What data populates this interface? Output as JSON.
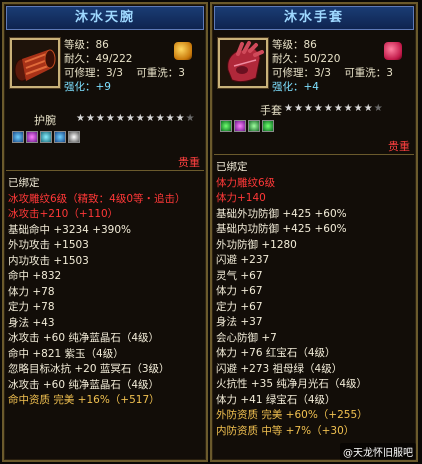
{
  "left": {
    "title": "沐水天腕",
    "info": {
      "level": "等级：86",
      "durability": "耐久：49/222",
      "repairable": "可修理：3/3",
      "rewash": "可重洗：3",
      "enhance_label": "强化：",
      "enhance_value": "+9"
    },
    "type": "护腕",
    "stars_filled": "★★★★★★★★★★★",
    "stars_dim": "★",
    "expensive": "贵重",
    "stats": [
      {
        "t": "已绑定",
        "c": "w"
      },
      {
        "t": "冰攻雕纹6级（精致：4级0等・追击）",
        "c": "r"
      },
      {
        "t": "冰攻击+210（+110）",
        "c": "r"
      },
      {
        "t": "基础命中 +3234 +390%",
        "c": "w"
      },
      {
        "t": "外功攻击 +1503",
        "c": "w"
      },
      {
        "t": "内功攻击 +1503",
        "c": "w"
      },
      {
        "t": "命中 +832",
        "c": "w"
      },
      {
        "t": "体力 +78",
        "c": "w"
      },
      {
        "t": "定力 +78",
        "c": "w"
      },
      {
        "t": "身法 +43",
        "c": "w"
      },
      {
        "t": "冰攻击 +60 纯净蓝晶石（4级）",
        "c": "w"
      },
      {
        "t": "命中 +821 紫玉（4级）",
        "c": "w"
      },
      {
        "t": "忽略目标冰抗 +20 蓝冥石（3级）",
        "c": "w"
      },
      {
        "t": "冰攻击 +60 纯净蓝晶石（4级）",
        "c": "w"
      },
      {
        "t": "命中资质  完美 +16%（+517）",
        "c": "y"
      }
    ]
  },
  "right": {
    "title": "沐水手套",
    "info": {
      "level": "等级：86",
      "durability": "耐久：50/220",
      "repairable": "可修理：3/3",
      "rewash": "可重洗：3",
      "enhance_label": "强化：",
      "enhance_value": "+4"
    },
    "type": "手套",
    "stars_filled": "★★★★★★★★★",
    "stars_dim": "★",
    "expensive": "贵重",
    "stats": [
      {
        "t": "已绑定",
        "c": "w"
      },
      {
        "t": "体力雕纹6级",
        "c": "r"
      },
      {
        "t": "体力+140",
        "c": "r"
      },
      {
        "t": "基础外功防御 +425 +60%",
        "c": "w"
      },
      {
        "t": "基础内功防御 +425 +60%",
        "c": "w"
      },
      {
        "t": "外功防御 +1280",
        "c": "w"
      },
      {
        "t": "闪避 +237",
        "c": "w"
      },
      {
        "t": "灵气 +67",
        "c": "w"
      },
      {
        "t": "体力 +67",
        "c": "w"
      },
      {
        "t": "定力 +67",
        "c": "w"
      },
      {
        "t": "身法 +37",
        "c": "w"
      },
      {
        "t": "会心防御 +7",
        "c": "w"
      },
      {
        "t": "体力 +76 红宝石（4级）",
        "c": "w"
      },
      {
        "t": "闪避 +273 祖母绿（4级）",
        "c": "w"
      },
      {
        "t": "火抗性 +35 纯净月光石（4级）",
        "c": "w"
      },
      {
        "t": "体力 +41 绿宝石（4级）",
        "c": "w"
      },
      {
        "t": "外防资质  完美 +60%（+255）",
        "c": "y"
      },
      {
        "t": "内防资质  中等 +7%（+30）",
        "c": "y"
      }
    ]
  },
  "watermark": "@天龙怀旧服吧",
  "colors": {
    "title_text": "#9ed8ff",
    "frame": "#6b5a2c",
    "red": "#ff3838",
    "cyan": "#6ef0ff",
    "gold": "#f0c050"
  }
}
